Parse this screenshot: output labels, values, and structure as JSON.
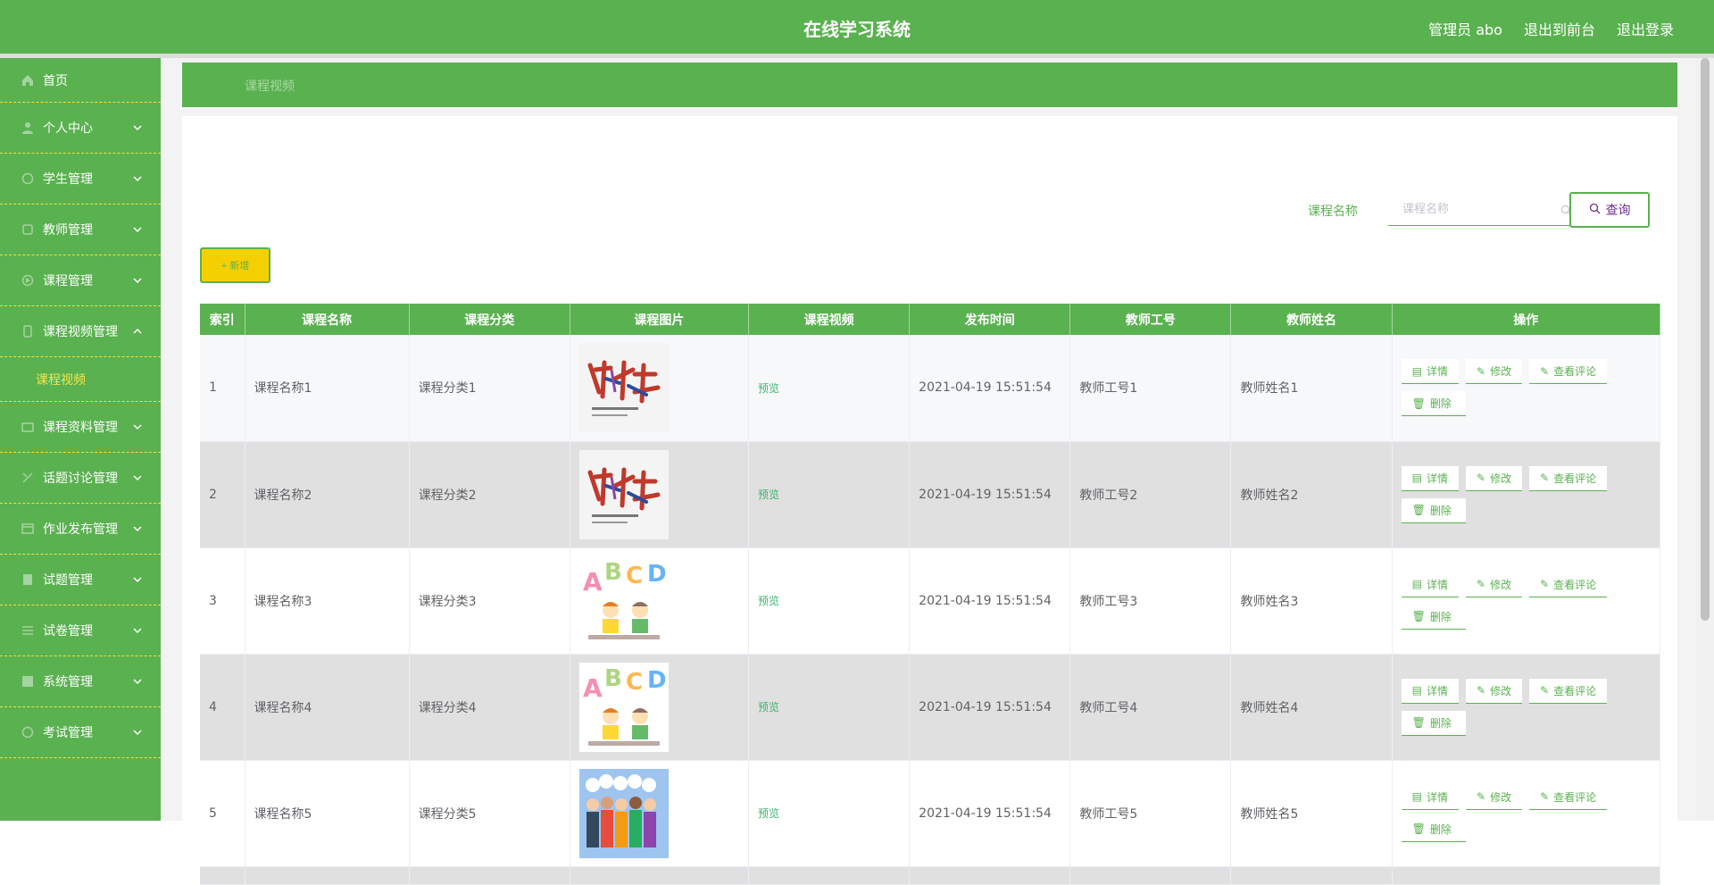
{
  "header": {
    "title": "在线学习系统",
    "user": "管理员 abo",
    "to_front": "退出到前台",
    "logout": "退出登录"
  },
  "sidebar": {
    "items": [
      {
        "label": "首页",
        "icon": "home-icon"
      },
      {
        "label": "个人中心",
        "icon": "user-icon"
      },
      {
        "label": "学生管理",
        "icon": "student-icon"
      },
      {
        "label": "教师管理",
        "icon": "teacher-icon"
      },
      {
        "label": "课程管理",
        "icon": "course-icon"
      },
      {
        "label": "课程视频管理",
        "icon": "video-icon",
        "expanded": true,
        "sub": "课程视频"
      },
      {
        "label": "课程资料管理",
        "icon": "folder-icon"
      },
      {
        "label": "话题讨论管理",
        "icon": "chat-icon"
      },
      {
        "label": "作业发布管理",
        "icon": "homework-icon"
      },
      {
        "label": "试题管理",
        "icon": "question-icon"
      },
      {
        "label": "试卷管理",
        "icon": "paper-icon"
      },
      {
        "label": "系统管理",
        "icon": "system-icon"
      },
      {
        "label": "考试管理",
        "icon": "exam-icon"
      }
    ]
  },
  "breadcrumb": {
    "current": "课程视频"
  },
  "search": {
    "label": "课程名称",
    "placeholder": "课程名称",
    "value": "",
    "button": "查询"
  },
  "toolbar": {
    "add_label": "+ 新增"
  },
  "table": {
    "columns": [
      "索引",
      "课程名称",
      "课程分类",
      "课程图片",
      "课程视频",
      "发布时间",
      "教师工号",
      "教师姓名",
      "操作"
    ],
    "rows": [
      {
        "index": "1",
        "name": "课程名称1",
        "category": "课程分类1",
        "image": "calligraphy-poster",
        "video": "预览",
        "time": "2021-04-19 15:51:54",
        "teacher_id": "教师工号1",
        "teacher_name": "教师姓名1"
      },
      {
        "index": "2",
        "name": "课程名称2",
        "category": "课程分类2",
        "image": "calligraphy-poster",
        "video": "预览",
        "time": "2021-04-19 15:51:54",
        "teacher_id": "教师工号2",
        "teacher_name": "教师姓名2"
      },
      {
        "index": "3",
        "name": "课程名称3",
        "category": "课程分类3",
        "image": "abcd-kids",
        "video": "预览",
        "time": "2021-04-19 15:51:54",
        "teacher_id": "教师工号3",
        "teacher_name": "教师姓名3"
      },
      {
        "index": "4",
        "name": "课程名称4",
        "category": "课程分类4",
        "image": "abcd-kids",
        "video": "预览",
        "time": "2021-04-19 15:51:54",
        "teacher_id": "教师工号4",
        "teacher_name": "教师姓名4"
      },
      {
        "index": "5",
        "name": "课程名称5",
        "category": "课程分类5",
        "image": "hello-people",
        "video": "预览",
        "time": "2021-04-19 15:51:54",
        "teacher_id": "教师工号5",
        "teacher_name": "教师姓名5"
      }
    ],
    "ops": {
      "detail": "详情",
      "edit": "修改",
      "comments": "查看评论",
      "delete": "删除"
    }
  },
  "colors": {
    "primary": "#5ab150",
    "accent_yellow": "#f5d000",
    "sub_menu_text": "#f6e54a"
  }
}
